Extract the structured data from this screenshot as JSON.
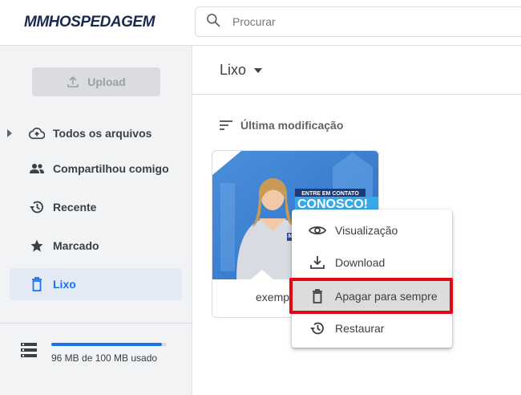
{
  "brand": {
    "logo_text": "MMHOSPEDAGEM"
  },
  "search": {
    "placeholder": "Procurar"
  },
  "sidebar": {
    "upload_label": "Upload",
    "items": [
      {
        "label": "Todos os arquivos",
        "icon": "cloud-upload-icon",
        "active": false
      },
      {
        "label": "Compartilhou comigo",
        "icon": "people-icon",
        "active": false
      },
      {
        "label": "Recente",
        "icon": "history-icon",
        "active": false
      },
      {
        "label": "Marcado",
        "icon": "star-icon",
        "active": false
      },
      {
        "label": "Lixo",
        "icon": "trash-icon",
        "active": true
      }
    ],
    "storage": {
      "text": "96 MB de 100 MB usado",
      "used_mb": 96,
      "total_mb": 100
    }
  },
  "main": {
    "folder_title": "Lixo",
    "sort_label": "Última modificação",
    "file": {
      "name_visible": "exemp",
      "thumb_banner_top": "ENTRE EM CONTATO",
      "thumb_banner_main": "CONOSCO!",
      "thumb_badge": "MM"
    }
  },
  "context_menu": {
    "items": [
      {
        "label": "Visualização",
        "icon": "eye-icon"
      },
      {
        "label": "Download",
        "icon": "download-icon"
      },
      {
        "label": "Apagar para sempre",
        "icon": "delete-forever-icon",
        "highlighted": true
      },
      {
        "label": "Restaurar",
        "icon": "restore-icon"
      }
    ]
  },
  "colors": {
    "accent": "#1a73e8",
    "highlight_border": "#e30613",
    "sidebar_bg": "#f1f3f4",
    "active_bg": "#e3eaf5"
  }
}
